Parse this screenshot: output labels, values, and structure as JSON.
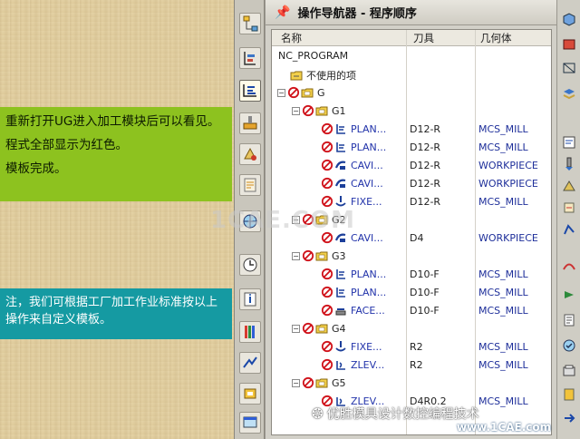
{
  "notes": {
    "green": [
      "重新打开UG进入加工模块后可以看见。",
      "程式全部显示为红色。",
      "模板完成。"
    ],
    "teal": "注，我们可根据工厂加工作业标准按以上操作来自定义模板。"
  },
  "navigator": {
    "title": "操作导航器 - 程序顺序",
    "columns": {
      "name": "名称",
      "tool": "刀具",
      "geometry": "几何体"
    },
    "rows": [
      {
        "name": "NC_PROGRAM",
        "tool": "",
        "geometry": "",
        "kind": "root"
      },
      {
        "name": "不使用的项",
        "tool": "",
        "geometry": "",
        "kind": "unused"
      },
      {
        "name": "G",
        "tool": "",
        "geometry": "",
        "kind": "group"
      },
      {
        "name": "G1",
        "tool": "",
        "geometry": "",
        "kind": "group"
      },
      {
        "name": "PLAN...",
        "tool": "D12-R",
        "geometry": "MCS_MILL",
        "kind": "planar-op"
      },
      {
        "name": "PLAN...",
        "tool": "D12-R",
        "geometry": "MCS_MILL",
        "kind": "planar-op"
      },
      {
        "name": "CAVI...",
        "tool": "D12-R",
        "geometry": "WORKPIECE",
        "kind": "cavity-op"
      },
      {
        "name": "CAVI...",
        "tool": "D12-R",
        "geometry": "WORKPIECE",
        "kind": "cavity-op"
      },
      {
        "name": "FIXE...",
        "tool": "D12-R",
        "geometry": "MCS_MILL",
        "kind": "fixed-op"
      },
      {
        "name": "G2",
        "tool": "",
        "geometry": "",
        "kind": "group"
      },
      {
        "name": "CAVI...",
        "tool": "D4",
        "geometry": "WORKPIECE",
        "kind": "cavity-op"
      },
      {
        "name": "G3",
        "tool": "",
        "geometry": "",
        "kind": "group"
      },
      {
        "name": "PLAN...",
        "tool": "D10-F",
        "geometry": "MCS_MILL",
        "kind": "planar-op"
      },
      {
        "name": "PLAN...",
        "tool": "D10-F",
        "geometry": "MCS_MILL",
        "kind": "planar-op"
      },
      {
        "name": "FACE...",
        "tool": "D10-F",
        "geometry": "MCS_MILL",
        "kind": "face-op"
      },
      {
        "name": "G4",
        "tool": "",
        "geometry": "",
        "kind": "group"
      },
      {
        "name": "FIXE...",
        "tool": "R2",
        "geometry": "MCS_MILL",
        "kind": "fixed-op"
      },
      {
        "name": "ZLEV...",
        "tool": "R2",
        "geometry": "MCS_MILL",
        "kind": "zlevel-op"
      },
      {
        "name": "G5",
        "tool": "",
        "geometry": "",
        "kind": "group"
      },
      {
        "name": "ZLEV...",
        "tool": "D4R0.2",
        "geometry": "MCS_MILL",
        "kind": "zlevel-op"
      }
    ]
  },
  "watermarks": {
    "center": "1CAE.COM",
    "bottom": "优胜模具设计数控编程技术",
    "site": "www.1CAE.com"
  },
  "colors": {
    "green_note": "#8dc21f",
    "teal_note": "#159aa2",
    "status_red": "#d0131b",
    "op_blue": "#2233aa"
  }
}
